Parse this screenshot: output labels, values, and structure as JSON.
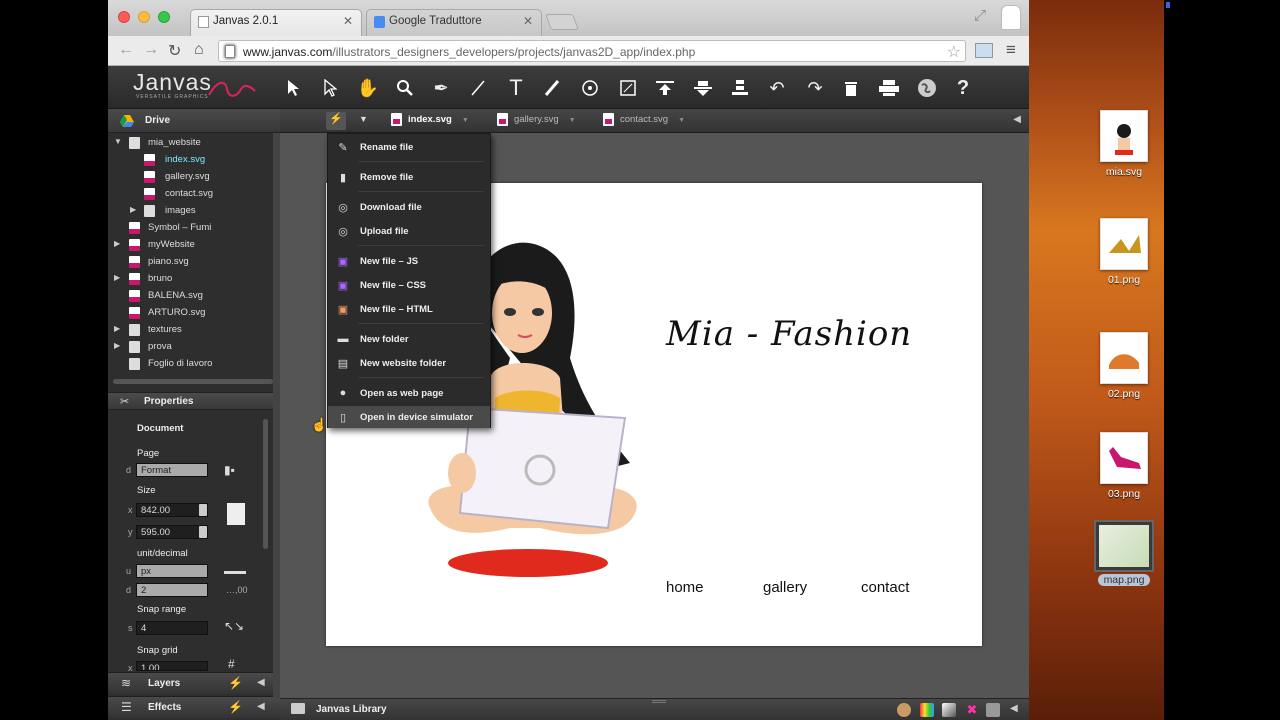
{
  "browser": {
    "tabs": [
      {
        "title": "Janvas 2.0.1",
        "active": true
      },
      {
        "title": "Google Traduttore",
        "active": false
      }
    ],
    "url_domain": "www.janvas.com",
    "url_path": "/illustrators_designers_developers/projects/janvas2D_app/index.php"
  },
  "app": {
    "logo": "Janvas",
    "logo_sub": "VERSATILE GRAPHICS",
    "toolbar_icons": [
      "select-arrow-icon",
      "direct-select-icon",
      "hand-icon",
      "zoom-icon",
      "pen-icon",
      "line-icon",
      "text-icon",
      "brush-icon",
      "circle-target-icon",
      "image-frame-icon",
      "align-top-icon",
      "align-middle-icon",
      "align-bottom-icon",
      "undo-icon",
      "redo-icon",
      "trash-icon",
      "print-icon",
      "globe-icon",
      "help-icon"
    ]
  },
  "drive": {
    "label": "Drive",
    "tree": [
      {
        "label": "mia_website",
        "expanded": true
      },
      {
        "label": "index.svg",
        "selected": true
      },
      {
        "label": "gallery.svg"
      },
      {
        "label": "contact.svg"
      },
      {
        "label": "images"
      },
      {
        "label": "Symbol – Fumi"
      },
      {
        "label": "myWebsite"
      },
      {
        "label": "piano.svg"
      },
      {
        "label": "bruno"
      },
      {
        "label": "BALENA.svg"
      },
      {
        "label": "ARTURO.svg"
      },
      {
        "label": "textures"
      },
      {
        "label": "prova"
      },
      {
        "label": "Foglio di lavoro"
      }
    ]
  },
  "file_tabs": [
    {
      "label": "index.svg",
      "active": true
    },
    {
      "label": "gallery.svg",
      "active": false
    },
    {
      "label": "contact.svg",
      "active": false
    }
  ],
  "context_menu": {
    "items": [
      {
        "label": "Rename file",
        "icon": "rename-icon"
      },
      {
        "label": "Remove file",
        "icon": "trash-icon"
      },
      {
        "label": "Download file",
        "icon": "download-icon"
      },
      {
        "label": "Upload file",
        "icon": "upload-icon"
      },
      {
        "label": "New file – JS",
        "icon": "js-file-icon"
      },
      {
        "label": "New file – CSS",
        "icon": "css-file-icon"
      },
      {
        "label": "New file – HTML",
        "icon": "html-file-icon"
      },
      {
        "label": "New folder",
        "icon": "folder-icon"
      },
      {
        "label": "New website folder",
        "icon": "website-folder-icon"
      },
      {
        "label": "Open as web page",
        "icon": "globe-icon"
      },
      {
        "label": "Open in device simulator",
        "icon": "device-icon",
        "highlighted": true
      }
    ]
  },
  "properties": {
    "label": "Properties",
    "document_label": "Document",
    "page_label": "Page",
    "page_prefix": "d",
    "page_format": "Format",
    "size_label": "Size",
    "width_prefix": "x",
    "width": "842.00",
    "height_prefix": "y",
    "height": "595.00",
    "unit_label": "unit/decimal",
    "unit_prefix": "u",
    "unit": "px",
    "decimal_prefix": "d",
    "decimal": "2",
    "decimal_hint": "…,00",
    "snap_range_label": "Snap range",
    "snap_range_prefix": "s",
    "snap_range": "4",
    "snap_grid_label": "Snap grid",
    "snap_grid_prefix": "x",
    "snap_grid": "1.00"
  },
  "panels": {
    "layers": "Layers",
    "effects": "Effects",
    "library": "Janvas Library"
  },
  "canvas": {
    "brand": "Mia - Fashion",
    "nav": [
      "home",
      "gallery",
      "contact"
    ]
  },
  "desktop": [
    {
      "label": "mia.svg"
    },
    {
      "label": "01.png"
    },
    {
      "label": "02.png"
    },
    {
      "label": "03.png"
    },
    {
      "label": "map.png",
      "selected": true
    }
  ]
}
